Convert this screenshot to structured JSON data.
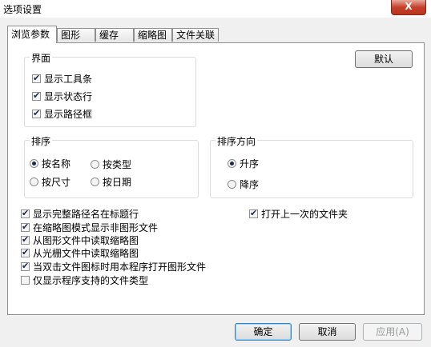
{
  "window": {
    "title": "选项设置",
    "close_label": "X"
  },
  "tabs": [
    {
      "label": "浏览参数",
      "active": true
    },
    {
      "label": "图形",
      "active": false
    },
    {
      "label": "缓存",
      "active": false
    },
    {
      "label": "缩略图",
      "active": false
    },
    {
      "label": "文件关联",
      "active": false
    }
  ],
  "interface_group": {
    "legend": "界面",
    "items": [
      {
        "label": "显示工具条",
        "checked": true
      },
      {
        "label": "显示状态行",
        "checked": true
      },
      {
        "label": "显示路径框",
        "checked": true
      }
    ]
  },
  "default_button": "默认",
  "sort_group": {
    "legend": "排序",
    "options": [
      {
        "label": "按名称",
        "selected": true
      },
      {
        "label": "按类型",
        "selected": false
      },
      {
        "label": "按尺寸",
        "selected": false
      },
      {
        "label": "按日期",
        "selected": false
      }
    ]
  },
  "sort_direction_group": {
    "legend": "排序方向",
    "options": [
      {
        "label": "升序",
        "selected": true
      },
      {
        "label": "降序",
        "selected": false
      }
    ]
  },
  "options": [
    {
      "label": "显示完整路径名在标题行",
      "checked": true
    },
    {
      "label": "在缩略图模式显示非图形文件",
      "checked": true
    },
    {
      "label": "从图形文件中读取缩略图",
      "checked": true
    },
    {
      "label": "从光栅文件中读取缩略图",
      "checked": true
    },
    {
      "label": "当双击文件图标时用本程序打开图形文件",
      "checked": true
    },
    {
      "label": "仅显示程序支持的文件类型",
      "checked": false
    }
  ],
  "open_last_folder": {
    "label": "打开上一次的文件夹",
    "checked": true
  },
  "footer": {
    "ok": "确定",
    "cancel": "取消",
    "apply": "应用(A)"
  }
}
